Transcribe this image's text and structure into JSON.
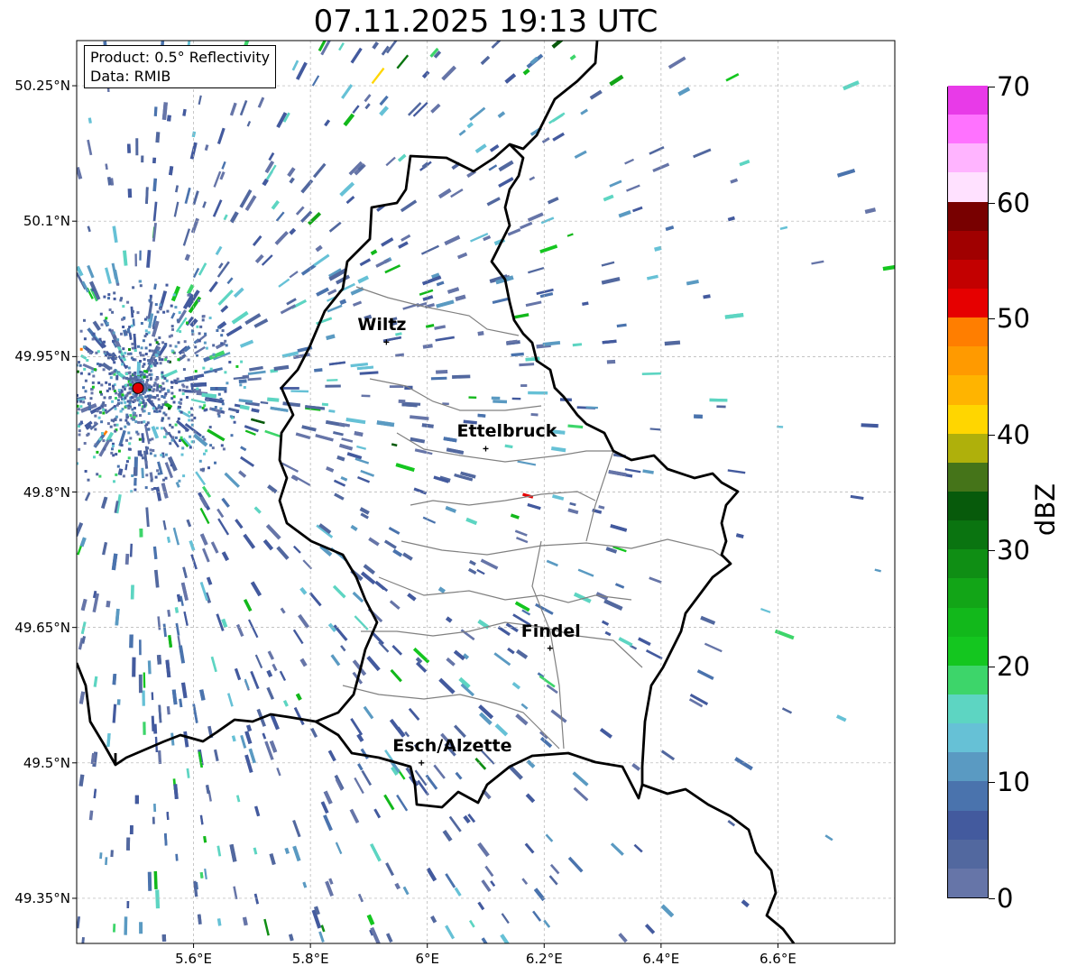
{
  "title": "07.11.2025 19:13 UTC",
  "info": {
    "product": "Product: 0.5° Reflectivity",
    "data": "Data: RMIB"
  },
  "axes": {
    "lon_ticks": [
      "5.6°E",
      "5.8°E",
      "6°E",
      "6.2°E",
      "6.4°E",
      "6.6°E"
    ],
    "lat_ticks": [
      "50.25°N",
      "50.1°N",
      "49.95°N",
      "49.8°N",
      "49.65°N",
      "49.5°N",
      "49.35°N"
    ],
    "lon_range": [
      5.4,
      6.8
    ],
    "lat_range": [
      49.3,
      50.3
    ]
  },
  "cities": [
    {
      "name": "Wiltz",
      "lon": 5.93,
      "lat": 49.966
    },
    {
      "name": "Ettelbruck",
      "lon": 6.1,
      "lat": 49.848
    },
    {
      "name": "Findel",
      "lon": 6.21,
      "lat": 49.627
    },
    {
      "name": "Esch/Alzette",
      "lon": 5.99,
      "lat": 49.5
    }
  ],
  "radar_site": {
    "lon": 5.505,
    "lat": 49.915
  },
  "colorbar": {
    "label": "dBZ",
    "ticks": [
      "0",
      "10",
      "20",
      "30",
      "40",
      "50",
      "60",
      "70"
    ],
    "min": 0,
    "max": 70,
    "step": 2.5,
    "colors": [
      "#6675a8",
      "#52689f",
      "#435a9e",
      "#4a73ad",
      "#5a9ac2",
      "#66c1d6",
      "#5dd5c2",
      "#3dd56a",
      "#14c61f",
      "#12b81b",
      "#12a517",
      "#0f8e14",
      "#0a7410",
      "#075a0b",
      "#457419",
      "#afb00b",
      "#ffd600",
      "#ffb400",
      "#ff9a00",
      "#ff7e00",
      "#e60000",
      "#c30000",
      "#a00000",
      "#780000",
      "#ffe1ff",
      "#ffb4ff",
      "#ff72ff",
      "#e83ae8"
    ]
  }
}
